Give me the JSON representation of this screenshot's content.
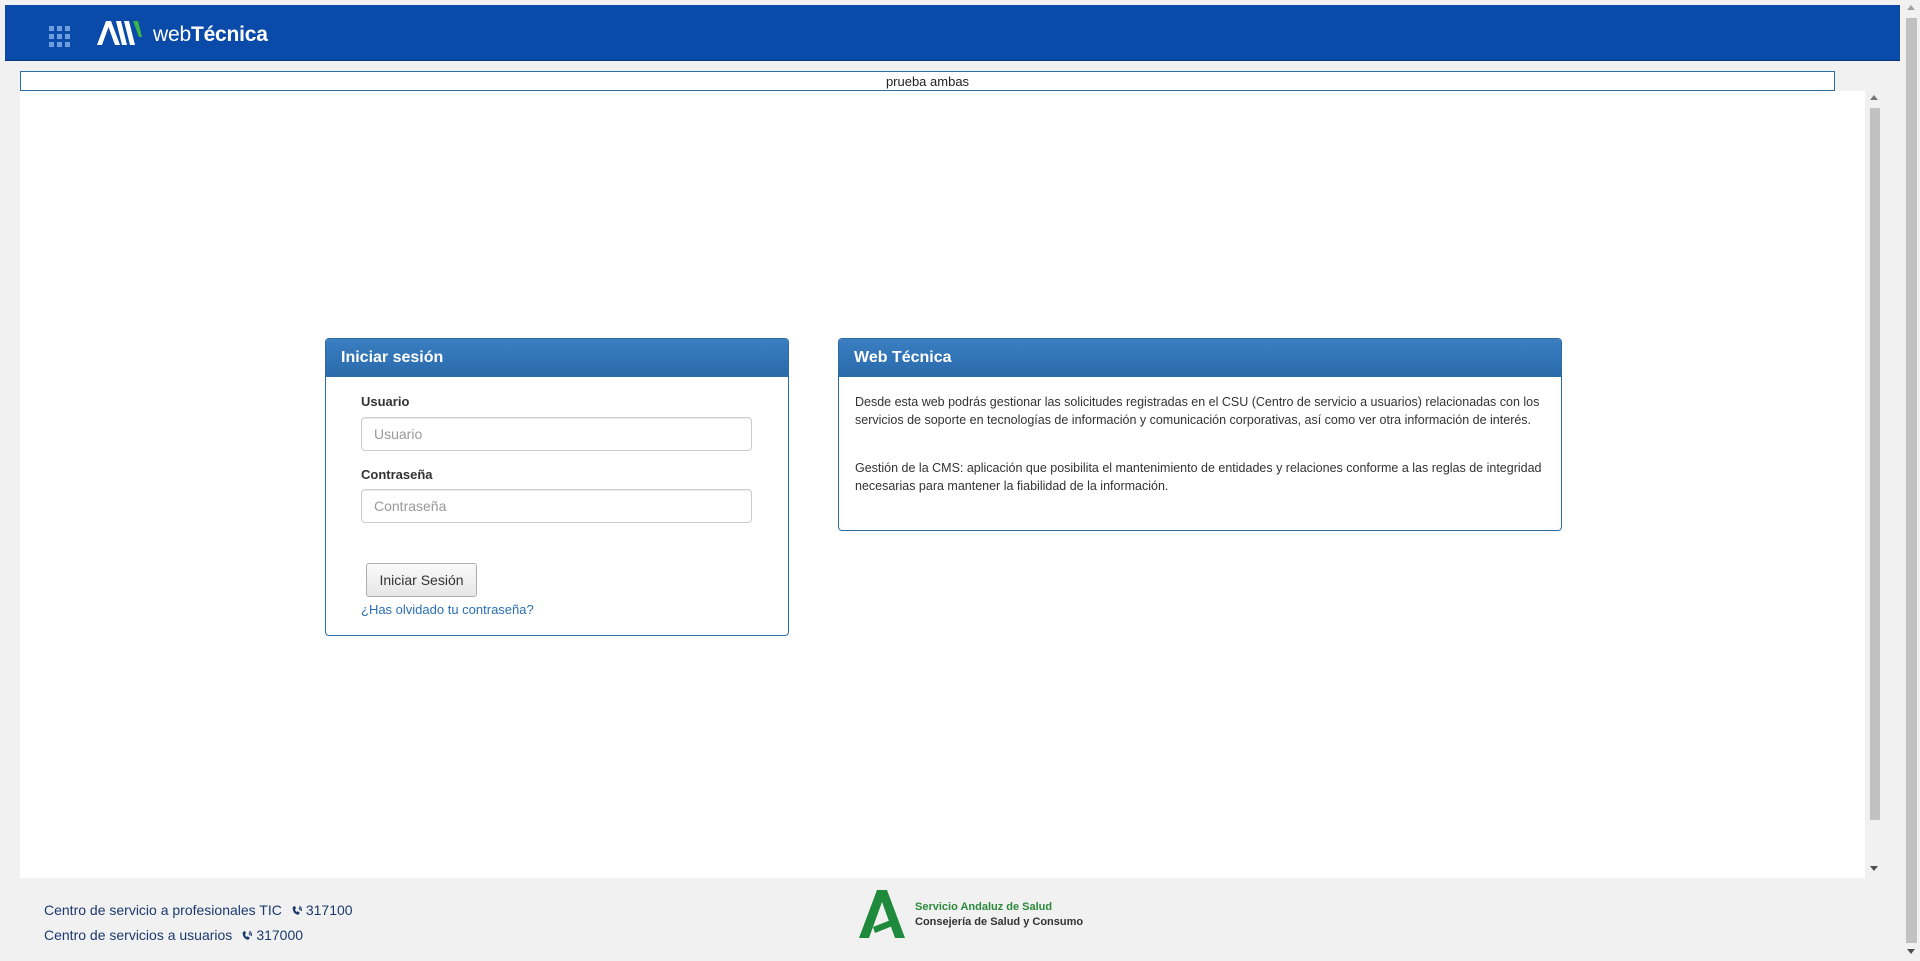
{
  "header": {
    "brand_light": "web",
    "brand_bold": "Técnica",
    "bg_color": "#0a4aa8"
  },
  "notice": {
    "text": "prueba ambas"
  },
  "login": {
    "title": "Iniciar sesión",
    "user_label": "Usuario",
    "user_placeholder": "Usuario",
    "password_label": "Contraseña",
    "password_placeholder": "Contraseña",
    "submit_label": "Iniciar Sesión",
    "forgot_label": "¿Has olvidado tu contraseña?"
  },
  "info": {
    "title": "Web Técnica",
    "paragraph1": "Desde esta web podrás gestionar las solicitudes registradas en el CSU (Centro de servicio a usuarios) relacionadas con los servicios de soporte en tecnologías de información y comunicación corporativas, así como ver otra información de interés.",
    "paragraph2": "Gestión de la CMS: aplicación que posibilita el mantenimiento de entidades y relaciones conforme a las reglas de integridad necesarias para mantener la fiabilidad de la información."
  },
  "footer": {
    "line1_label": "Centro de servicio a profesionales TIC",
    "line1_phone": "317100",
    "line2_label": "Centro de servicios a usuarios",
    "line2_phone": "317000",
    "logo_line1": "Servicio Andaluz de Salud",
    "logo_line2": "Consejería de Salud y Consumo"
  },
  "icons": {
    "apps": "grid-apps-icon",
    "phone": "phone-icon"
  }
}
